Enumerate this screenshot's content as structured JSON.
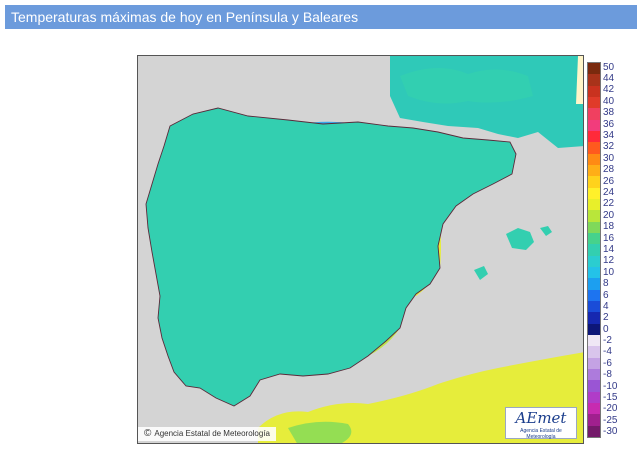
{
  "title": "Temperaturas máximas de hoy en Península y Baleares",
  "map": {
    "credit": "Agencia Estatal de Meteorología",
    "credit_symbol": "©",
    "logo_main": "AEmet",
    "logo_sub": "Agencia Estatal de Meteorología"
  },
  "scale": {
    "unit_note": "",
    "entries": [
      {
        "label": "50",
        "color": "#7a2a0e"
      },
      {
        "label": "44",
        "color": "#a8331a"
      },
      {
        "label": "42",
        "color": "#c9321f"
      },
      {
        "label": "40",
        "color": "#e03b2a"
      },
      {
        "label": "38",
        "color": "#f04060"
      },
      {
        "label": "36",
        "color": "#f23c7c"
      },
      {
        "label": "34",
        "color": "#ff2a3a"
      },
      {
        "label": "32",
        "color": "#ff5a1e"
      },
      {
        "label": "30",
        "color": "#ff8a14"
      },
      {
        "label": "28",
        "color": "#ffae17"
      },
      {
        "label": "26",
        "color": "#ffd21c"
      },
      {
        "label": "24",
        "color": "#fff02a"
      },
      {
        "label": "22",
        "color": "#e8ef2a"
      },
      {
        "label": "20",
        "color": "#b9e63a"
      },
      {
        "label": "18",
        "color": "#7fd95a"
      },
      {
        "label": "16",
        "color": "#46d28c"
      },
      {
        "label": "14",
        "color": "#33cfb0"
      },
      {
        "label": "12",
        "color": "#2bcdd0"
      },
      {
        "label": "10",
        "color": "#24c2e8"
      },
      {
        "label": "8",
        "color": "#1c9ff0"
      },
      {
        "label": "6",
        "color": "#1d74f0"
      },
      {
        "label": "4",
        "color": "#1a4cd8"
      },
      {
        "label": "2",
        "color": "#1628b0"
      },
      {
        "label": "0",
        "color": "#0d1678"
      },
      {
        "label": "-2",
        "color": "#efe7f5"
      },
      {
        "label": "-4",
        "color": "#d9c5ec"
      },
      {
        "label": "-6",
        "color": "#c4a2e4"
      },
      {
        "label": "-8",
        "color": "#ad7bdc"
      },
      {
        "label": "-10",
        "color": "#9a55d4"
      },
      {
        "label": "-15",
        "color": "#b03cc8"
      },
      {
        "label": "-20",
        "color": "#c72bb0"
      },
      {
        "label": "-25",
        "color": "#a0208e"
      },
      {
        "label": "-30",
        "color": "#741a6a"
      }
    ]
  },
  "colors": {
    "title_bg": "#6c9bdc",
    "land_dominant": "#33cfb0",
    "sea": "#d4d4d4",
    "cold_highlands": "#1d74f0",
    "warm_coast": "#e8ef2a"
  }
}
